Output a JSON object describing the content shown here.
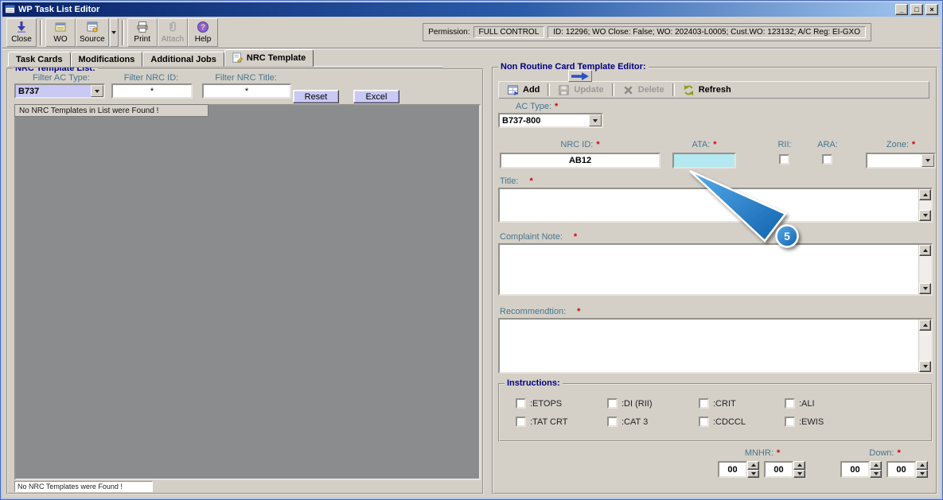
{
  "window": {
    "title": "WP Task List Editor",
    "minimize_glyph": "_",
    "maximize_glyph": "□",
    "close_glyph": "×"
  },
  "toolbar": {
    "close": "Close",
    "wo": "WO",
    "source": "Source",
    "print": "Print",
    "attach": "Attach",
    "help": "Help"
  },
  "permission": {
    "label": "Permission:",
    "value": "FULL CONTROL",
    "context": "ID: 12296; WO Close: False; WO: 202403-L0005; Cust.WO: 123132; A/C Reg: EI-GXO"
  },
  "tabs": [
    {
      "label": "Task Cards"
    },
    {
      "label": "Modifications"
    },
    {
      "label": "Additional Jobs"
    },
    {
      "label": "NRC Template"
    }
  ],
  "required": "*",
  "left_panel": {
    "title": "NRC Template List:",
    "filter_ac_type_label": "Filter AC Type:",
    "filter_ac_type_value": "B737",
    "filter_nrc_id_label": "Filter NRC ID:",
    "filter_nrc_id_value": "*",
    "filter_nrc_title_label": "Filter NRC Title:",
    "filter_nrc_title_value": "*",
    "reset_button": "Reset",
    "excel_button": "Excel",
    "empty_message": "No NRC Templates in List were Found !",
    "status_message": "No NRC Templates were Found !"
  },
  "right_panel": {
    "title": "Non Routine Card Template Editor:",
    "toolbar": {
      "add": "Add",
      "update": "Update",
      "delete": "Delete",
      "refresh": "Refresh"
    },
    "ac_type_label": "AC Type:",
    "ac_type_value": "B737-800",
    "nrc_id_label": "NRC ID:",
    "nrc_id_value": "AB12",
    "ata_label": "ATA:",
    "ata_value": "",
    "rii_label": "RII:",
    "ara_label": "ARA:",
    "zone_label": "Zone:",
    "zone_value": "",
    "title_label": "Title:",
    "title_value": "",
    "complaint_label": "Complaint Note:",
    "complaint_value": "",
    "recommendation_label": "Recommendtion:",
    "recommendation_value": "",
    "instructions": {
      "title": "Instructions:",
      "items": [
        ":ETOPS",
        ":DI (RII)",
        ":CRIT",
        ":ALI",
        ":TAT CRT",
        ":CAT 3",
        ":CDCCL",
        ":EWIS"
      ]
    },
    "mnhr_label": "MNHR:",
    "mnhr_values": [
      "00",
      "00"
    ],
    "down_label": "Down:",
    "down_values": [
      "00",
      "00"
    ]
  },
  "callout": {
    "number": "5"
  },
  "colors": {
    "chrome": "#d4d0c8",
    "title-start": "#0a246a",
    "title-mid": "#2a5ba8",
    "title-end": "#a6caf0",
    "lavender": "#c9c9f4",
    "highlight-cyan": "#b5e9f2",
    "list-gray": "#8a8c8e",
    "label-teal": "#49758c",
    "navy": "#000080",
    "required-red": "#d40000",
    "callout-light": "#55acea",
    "callout-dark": "#1262ae"
  }
}
